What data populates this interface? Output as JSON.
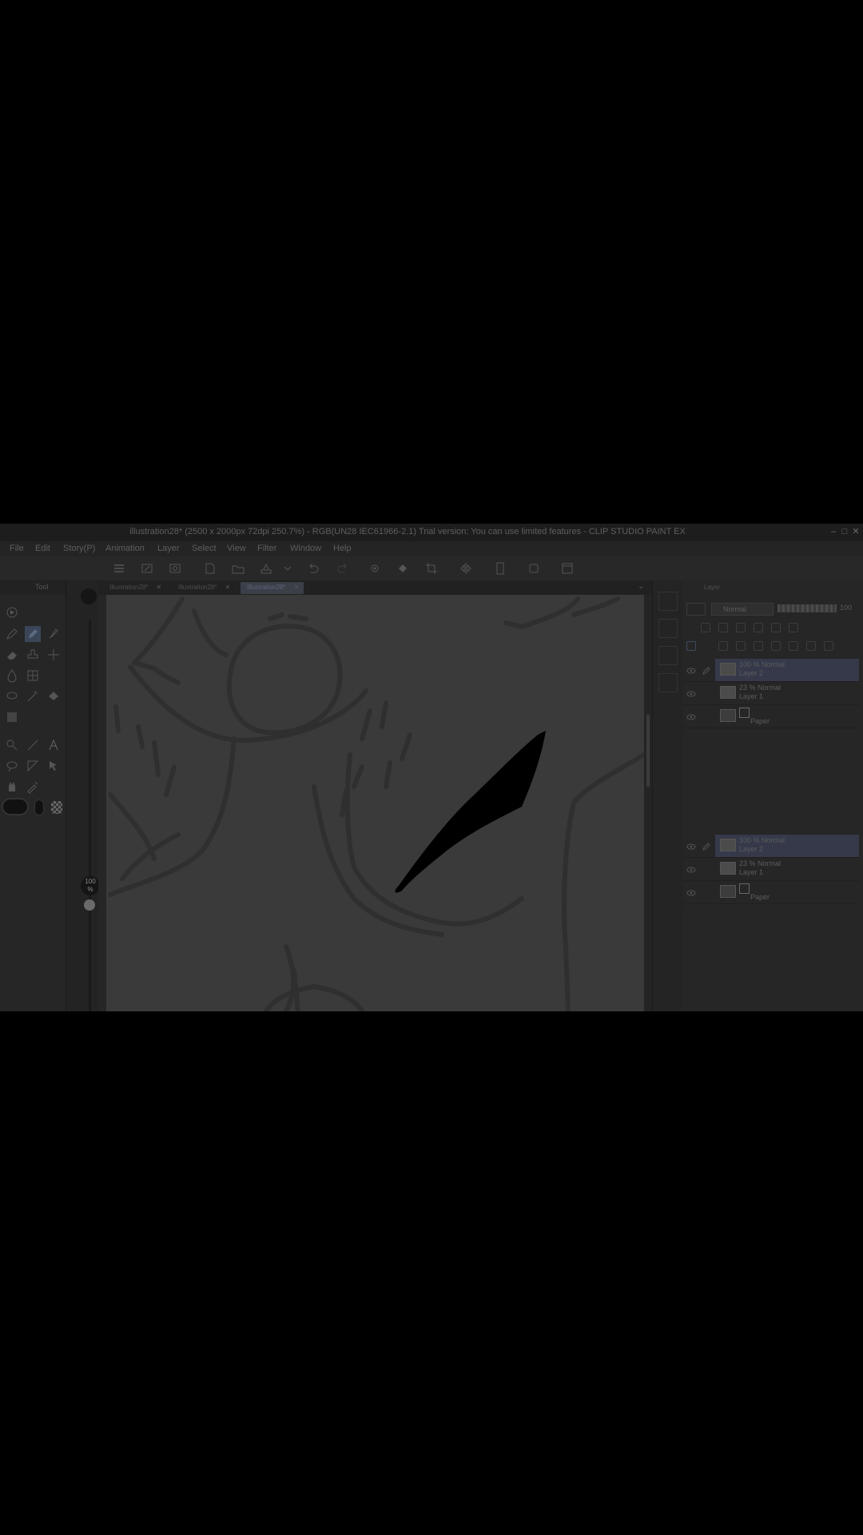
{
  "window": {
    "title": "illustration28* (2500 x 2000px 72dpi 250.7%) - RGB(UN28 IEC61966-2.1) Trial version: You can use limited features - CLIP STUDIO PAINT EX"
  },
  "menu": {
    "items": [
      "File",
      "Edit",
      "Story(P)",
      "Animation",
      "Layer",
      "Select",
      "View",
      "Filter",
      "Window",
      "Help"
    ]
  },
  "tool_panel": {
    "label": "Tool"
  },
  "brush_size": {
    "value": "100",
    "unit": "%"
  },
  "document_tabs": [
    {
      "label": "Illustration28*"
    },
    {
      "label": "Illustration28*"
    },
    {
      "label": "Illustration28*"
    }
  ],
  "layer_panel": {
    "tab_label": "Layer",
    "blend_mode": "Normal",
    "opacity_value": "100",
    "groups": [
      {
        "layers": [
          {
            "mode": "100 % Normal",
            "name": "Layer 2",
            "active": true
          },
          {
            "mode": "23 % Normal",
            "name": "Layer 1",
            "active": false
          },
          {
            "mode": "",
            "name": "Paper",
            "active": false
          }
        ]
      },
      {
        "layers": [
          {
            "mode": "100 % Normal",
            "name": "Layer 2",
            "active": true
          },
          {
            "mode": "23 % Normal",
            "name": "Layer 1",
            "active": false
          },
          {
            "mode": "",
            "name": "Paper",
            "active": false
          }
        ]
      }
    ]
  },
  "colors": {
    "background_dim": "#000000",
    "ui_dark": "#2a2a2a",
    "canvas": "#3a3a3a",
    "stroke": "#2e2e2e",
    "active_layer": "#35394a"
  }
}
